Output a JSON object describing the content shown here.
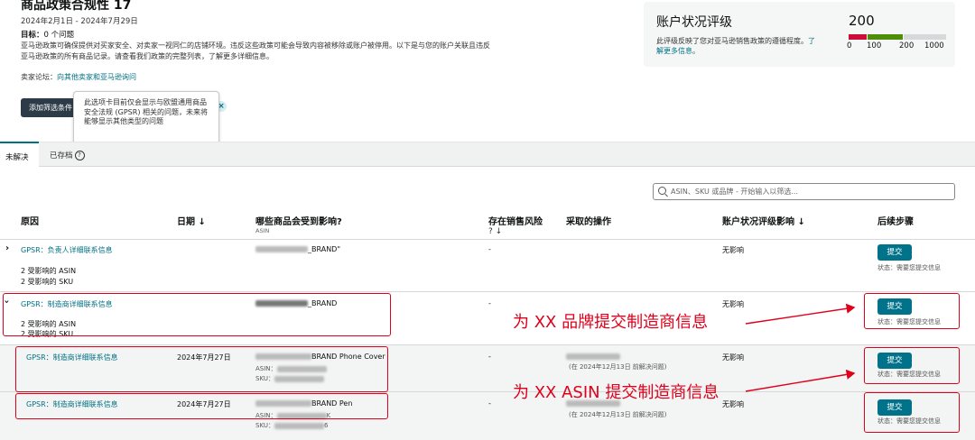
{
  "header": {
    "title": "商品政策合规性 17",
    "date_range": "2024年2月1日 - 2024年7月29日",
    "target_label": "目标：",
    "target_value": "0 个问题",
    "description": "亚马逊政策可确保提供对买家安全、对卖家一视同仁的店铺环境。违反这些政策可能会导致内容被移除或账户被停用。以下是与您的账户关联且违反亚马逊政策的所有商品记录。请查看我们政策的完整列表，了解更多详细信息。",
    "forum_label": "卖家论坛：",
    "forum_link": "向其他卖家和亚马逊询问",
    "add_filter_label": "添加筛选条件",
    "close_symbol": "×",
    "tooltip": "此选项卡目前仅会显示与欧盟通用商品安全法规 (GPSR) 相关的问题，未来将能够显示其他类型的问题"
  },
  "health": {
    "title": "账户状况评级",
    "description": "此评级反映了您对亚马逊销售政策的遵循程度。",
    "learn_more": "了解更多信息。",
    "score": "200",
    "gauge_labels": [
      "0",
      "100",
      "200",
      "1000"
    ],
    "colors": {
      "red": "#cc0c39",
      "green": "#4d8d0a",
      "gray": "#d5d9d9"
    }
  },
  "tabs": [
    {
      "label": "未解决",
      "active": true
    },
    {
      "label": "已存档",
      "help_icon": "?"
    }
  ],
  "search": {
    "placeholder": "ASIN、SKU 或品牌 - 开始输入以筛选..."
  },
  "table": {
    "columns": [
      {
        "label": "原因"
      },
      {
        "label": "日期 ↓"
      },
      {
        "label": "哪些商品会受到影响?",
        "sub": "ASIN"
      },
      {
        "label": "存在销售风险",
        "sub": "? ↓"
      },
      {
        "label": "采取的操作"
      },
      {
        "label": "账户状况评级影响 ↓"
      },
      {
        "label": "后续步骤"
      }
    ],
    "rows": [
      {
        "reason": "GPSR：负责人详细联系信息",
        "asin_count": "2 受影响的 ASIN",
        "sku_count": "2 受影响的 SKU",
        "product": "_BRAND\"",
        "risk": "-",
        "impact": "无影响",
        "action": "提交",
        "status": "状态：需要您提交信息"
      },
      {
        "reason": "GPSR：制造商详细联系信息",
        "asin_count": "2 受影响的 ASIN",
        "sku_count": "2 受影响的 SKU",
        "product": "_BRAND",
        "risk": "-",
        "impact": "无影响",
        "action": "提交",
        "status": "状态：需要您提交信息"
      },
      {
        "reason": "GPSR：制造商详细联系信息",
        "date": "2024年7月27日",
        "product": "BRAND Phone Cover",
        "asin_label": "ASIN：",
        "sku_label": "SKU：",
        "risk": "-",
        "taken": "(在 2024年12月13日 前解决问题)",
        "impact": "无影响",
        "action": "提交",
        "status": "状态：需要您提交信息"
      },
      {
        "reason": "GPSR：制造商详细联系信息",
        "date": "2024年7月27日",
        "product": "BRAND Pen",
        "asin_label": "ASIN：",
        "asin_tail": "K",
        "sku_label": "SKU：",
        "sku_tail": "6",
        "risk": "-",
        "taken": "(在 2024年12月13日 前解决问题)",
        "impact": "无影响",
        "action": "提交",
        "status": "状态：需要您提交信息"
      }
    ]
  },
  "annotations": {
    "brand": "为 XX 品牌提交制造商信息",
    "asin": "为 XX ASIN 提交制造商信息"
  }
}
